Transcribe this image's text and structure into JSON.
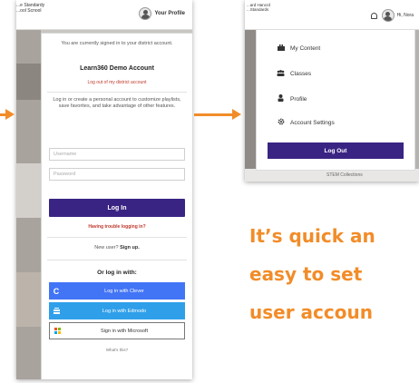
{
  "left_screen": {
    "district_text": "...e Standardy\n...ool Scnool",
    "profile_label": "Your Profile",
    "signed_in_message": "You are currently signed in to your district account.",
    "account_name": "Learn360 Demo Account",
    "logout_district_link": "Log out of my district account",
    "personal_account_message": "Log in or create a personal account to customize playlists, save favorites, and take advantage of other features.",
    "username_placeholder": "Username",
    "password_placeholder": "Password",
    "login_button": "Log In",
    "trouble_link": "Having trouble logging in?",
    "new_user_prefix": "New user?",
    "new_user_link": "Sign up.",
    "or_login_with": "Or log in with:",
    "clever_label": "Log in with Clever",
    "clever_icon_glyph": "C",
    "edmodo_label": "Log in with Edmodo",
    "microsoft_label": "Sign in with Microsoft",
    "whats_this": "What's this?"
  },
  "right_screen": {
    "district_text": "...ard Hancrd\n...Standards",
    "user_label": "Hi, Nora",
    "menu": [
      {
        "label": "My Content",
        "icon": "briefcase-icon"
      },
      {
        "label": "Classes",
        "icon": "users-icon"
      },
      {
        "label": "Profile",
        "icon": "user-icon"
      },
      {
        "label": "Account Settings",
        "icon": "gear-icon"
      }
    ],
    "logout_button": "Log Out",
    "bottom_text": "STEM Collections"
  },
  "tagline": [
    "It’s quick an",
    "easy to set",
    "user accoun"
  ],
  "colors": {
    "accent_orange": "#f28c28",
    "brand_purple": "#3a2483",
    "clever_blue": "#4274f6",
    "edmodo_blue": "#2f9fea",
    "link_red": "#c0392b"
  }
}
